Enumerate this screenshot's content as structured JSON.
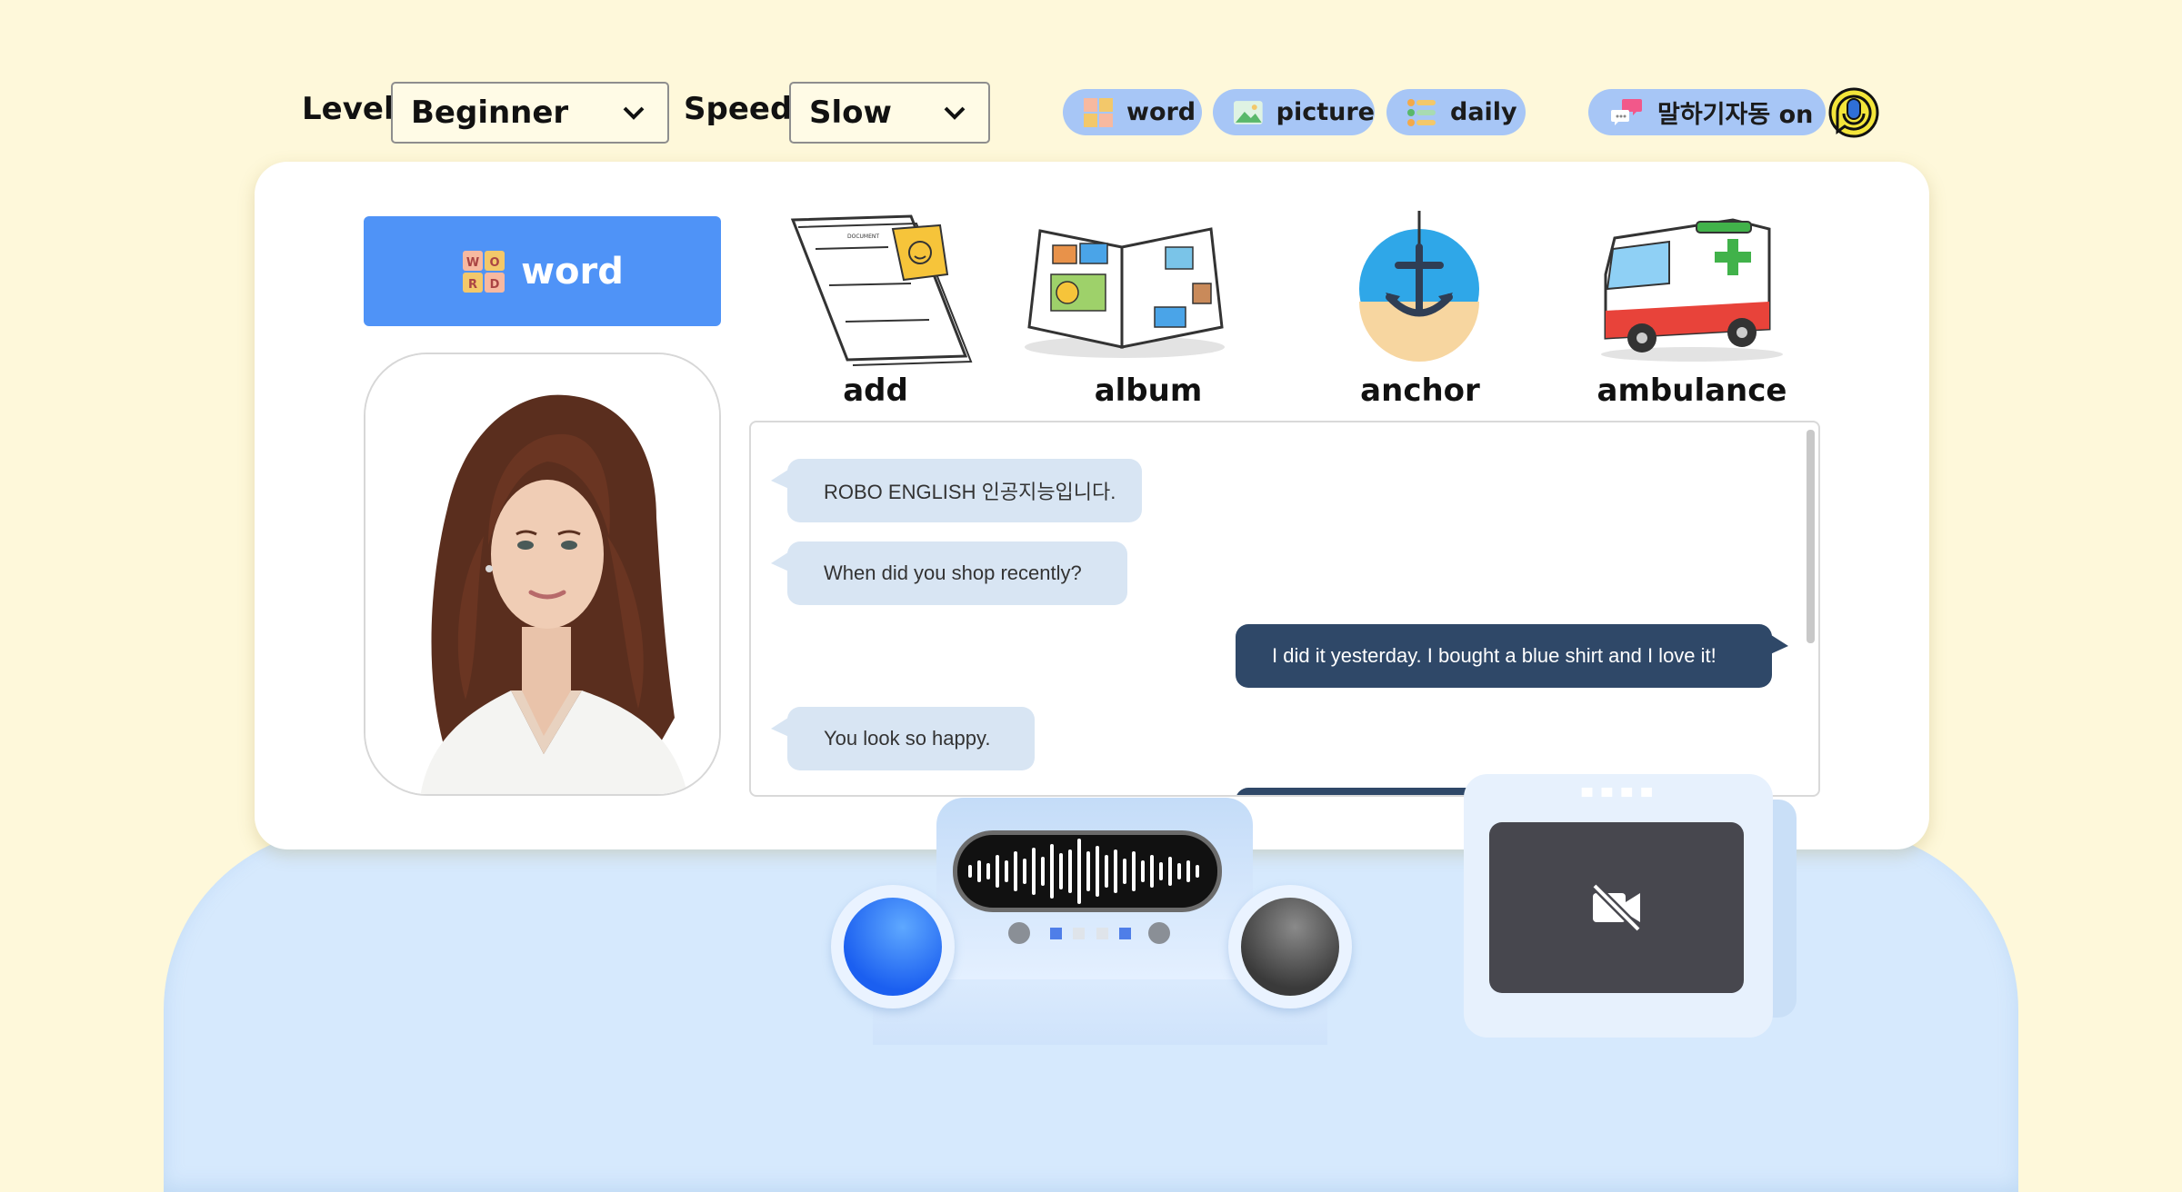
{
  "controls": {
    "level_label": "Level",
    "level_value": "Beginner",
    "speed_label": "Speed",
    "speed_value": "Slow"
  },
  "mode_pills": [
    {
      "label": "word",
      "icon": "word-tiles-icon"
    },
    {
      "label": "picture",
      "icon": "picture-icon"
    },
    {
      "label": "daily",
      "icon": "daily-list-icon"
    }
  ],
  "auto_speak": {
    "label": "말하기자동 on",
    "icon": "chat-bubbles-icon"
  },
  "mic_icon": "microphone-icon",
  "active_mode": {
    "label": "word",
    "icon": "word-tiles-icon"
  },
  "words": [
    {
      "label": "add",
      "icon": "document-note-icon"
    },
    {
      "label": "album",
      "icon": "photo-album-icon"
    },
    {
      "label": "anchor",
      "icon": "anchor-icon"
    },
    {
      "label": "ambulance",
      "icon": "ambulance-icon"
    }
  ],
  "doc_title": "DOCUMENT",
  "chat": [
    {
      "from": "bot",
      "text": "ROBO ENGLISH 인공지능입니다."
    },
    {
      "from": "bot",
      "text": "When did you shop recently?"
    },
    {
      "from": "user",
      "text": "I did it yesterday. I bought a blue shirt and I love it!"
    },
    {
      "from": "bot",
      "text": "You look so happy."
    }
  ],
  "colors": {
    "background": "#fef8da",
    "accent": "#4f93f7",
    "pill": "#a7c6f6",
    "bot_bubble": "#d8e5f3",
    "user_bubble": "#2f4868"
  },
  "device": {
    "left_knob": "blue-knob",
    "right_knob": "dark-knob",
    "camera_icon": "camera-off-icon"
  }
}
